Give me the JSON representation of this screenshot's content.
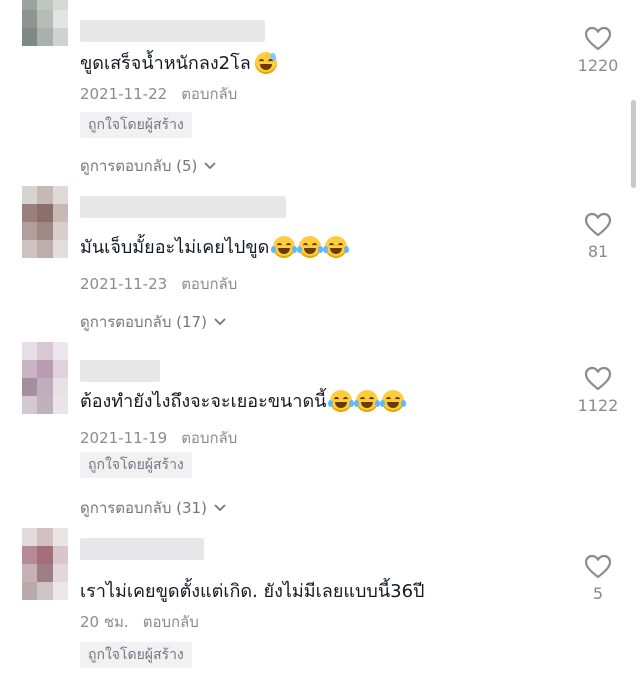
{
  "comments": [
    {
      "text": "ขูดเสร็จน้ำหนักลง2โล",
      "emoji": "sweat-smile",
      "date": "2021-11-22",
      "reply_label": "ตอบกลับ",
      "badge": "ถูกใจโดยผู้สร้าง",
      "view_replies": "ดูการตอบกลับ (5)",
      "likes": "1220"
    },
    {
      "text": "มันเจ็บมั้ยอะไม่เคยไปขูด",
      "emoji": "tears-of-joy x3",
      "date": "2021-11-23",
      "reply_label": "ตอบกลับ",
      "view_replies": "ดูการตอบกลับ (17)",
      "likes": "81"
    },
    {
      "text": "ต้องทำยังไงถึงจะจะเยอะขนาดนี้",
      "emoji": "tears-of-joy x3",
      "date": "2021-11-19",
      "reply_label": "ตอบกลับ",
      "badge": "ถูกใจโดยผู้สร้าง",
      "view_replies": "ดูการตอบกลับ (31)",
      "likes": "1122"
    },
    {
      "text": "เราไม่เคยขูดตั้งแต่เกิด. ยังไม่มีเลยแบบนี้36ปี",
      "date": "20 ชม.",
      "reply_label": "ตอบกลับ",
      "badge": "ถูกใจโดยผู้สร้าง",
      "likes": "5"
    }
  ],
  "colors": {
    "primary_text": "#161823",
    "secondary_text": "#8a8b91",
    "badge_bg": "#f1f1f3"
  },
  "icons": {
    "like": "heart-outline-icon",
    "expand": "chevron-down-icon"
  }
}
